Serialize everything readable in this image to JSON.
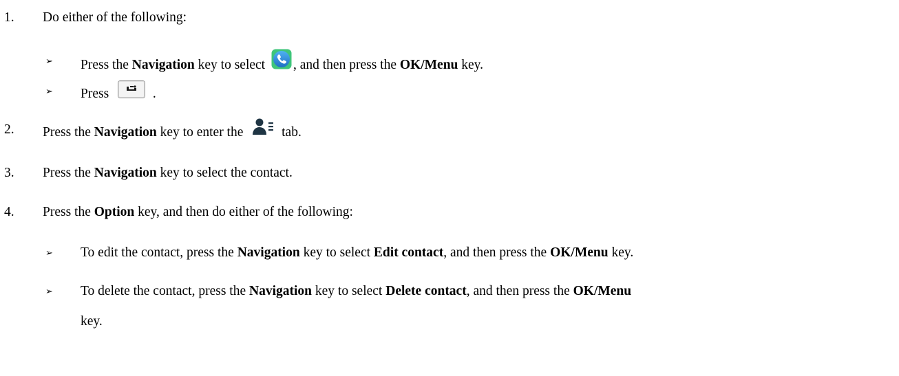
{
  "steps": [
    {
      "number": "1.",
      "parts": [
        "Do either of the following:"
      ]
    },
    {
      "number": "2.",
      "parts": [
        "Press the ",
        "Navigation",
        " key to enter the ",
        " tab."
      ]
    },
    {
      "number": "3.",
      "parts": [
        "Press the ",
        "Navigation",
        " key to select the contact."
      ]
    },
    {
      "number": "4.",
      "parts": [
        "Press the ",
        "Option",
        " key, and then do either of the following:"
      ]
    }
  ],
  "bullet_glyph": "➢",
  "substeps_1": [
    {
      "parts": [
        "Press the ",
        "Navigation",
        " key to select ",
        ", and then press the ",
        "OK/Menu",
        " key."
      ]
    },
    {
      "parts": [
        "Press ",
        " ."
      ]
    }
  ],
  "substeps_4": [
    {
      "parts": [
        "To edit the contact, press the ",
        "Navigation",
        " key to select ",
        "Edit contact",
        ", and then press the ",
        "OK/Menu",
        " key."
      ]
    },
    {
      "parts": [
        "To delete the contact, press the ",
        "Navigation",
        " key to select ",
        "Delete contact",
        ", and then press the ",
        "OK/Menu"
      ],
      "continuation": "key."
    }
  ],
  "icons": {
    "phone_app": "phone-icon",
    "handset_key": "handset-key-icon",
    "contacts_tab": "contacts-icon"
  },
  "colors": {
    "phone_icon_bg": "#2f86d6",
    "contacts_icon": "#1f3544"
  }
}
